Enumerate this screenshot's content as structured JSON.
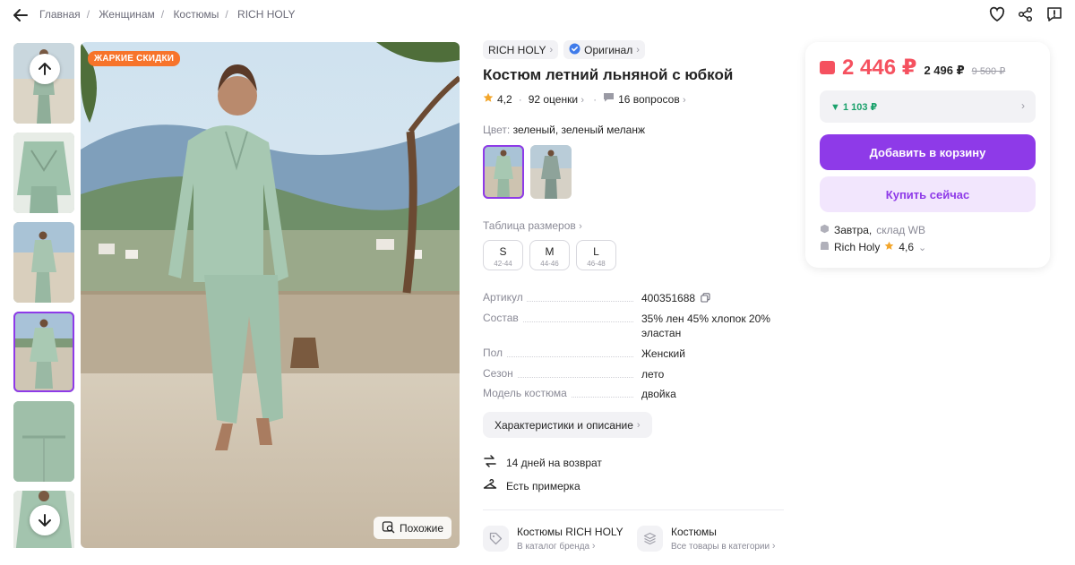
{
  "breadcrumb": [
    "Главная",
    "Женщинам",
    "Костюмы",
    "RICH HOLY"
  ],
  "gallery": {
    "badge": "ЖАРКИЕ СКИДКИ",
    "similar_label": "Похожие",
    "selected_thumb_index": 3
  },
  "product": {
    "brand": "RICH HOLY",
    "original_label": "Оригинал",
    "title": "Костюм летний льняной с юбкой",
    "rating": "4,2",
    "reviews": "92 оценки",
    "questions": "16 вопросов",
    "color_label": "Цвет:",
    "color_value": "зеленый, зеленый меланж",
    "sizes_title": "Таблица размеров",
    "sizes": [
      {
        "size": "S",
        "range": "42-44"
      },
      {
        "size": "M",
        "range": "44-46"
      },
      {
        "size": "L",
        "range": "46-48"
      }
    ],
    "specs": [
      {
        "key": "Артикул",
        "value": "400351688"
      },
      {
        "key": "Состав",
        "value": "35% лен 45% хлопок 20% эластан"
      },
      {
        "key": "Пол",
        "value": "Женский"
      },
      {
        "key": "Сезон",
        "value": "лето"
      },
      {
        "key": "Модель костюма",
        "value": "двойка"
      }
    ],
    "chars_button": "Характеристики и описание",
    "features": [
      "14 дней на возврат",
      "Есть примерка"
    ],
    "links": [
      {
        "title": "Костюмы RICH HOLY",
        "subtitle": "В каталог бренда"
      },
      {
        "title": "Костюмы",
        "subtitle": "Все товары в категории"
      }
    ]
  },
  "price_card": {
    "price": "2 446 ₽",
    "price_no_wallet": "2 496 ₽",
    "price_old": "9 500 ₽",
    "cashback": "▼ 1 103 ₽",
    "add_to_cart": "Добавить в корзину",
    "buy_now": "Купить сейчас",
    "delivery_day": "Завтра,",
    "delivery_warehouse": "склад WB",
    "seller_name": "Rich Holy",
    "seller_rating": "4,6"
  },
  "colors": {
    "accent": "#8e3ae8",
    "price": "#f5515f",
    "cashback": "#1aa16b",
    "badge": "#f7742b"
  },
  "icons": [
    "back-arrow-icon",
    "heart-icon",
    "share-icon",
    "report-icon",
    "arrow-up-icon",
    "arrow-down-icon",
    "search-similar-icon",
    "star-icon",
    "chat-icon",
    "verified-icon",
    "copy-icon",
    "return-icon",
    "hanger-icon",
    "tag-icon",
    "stack-icon",
    "wallet-icon",
    "box-icon",
    "shop-icon"
  ]
}
